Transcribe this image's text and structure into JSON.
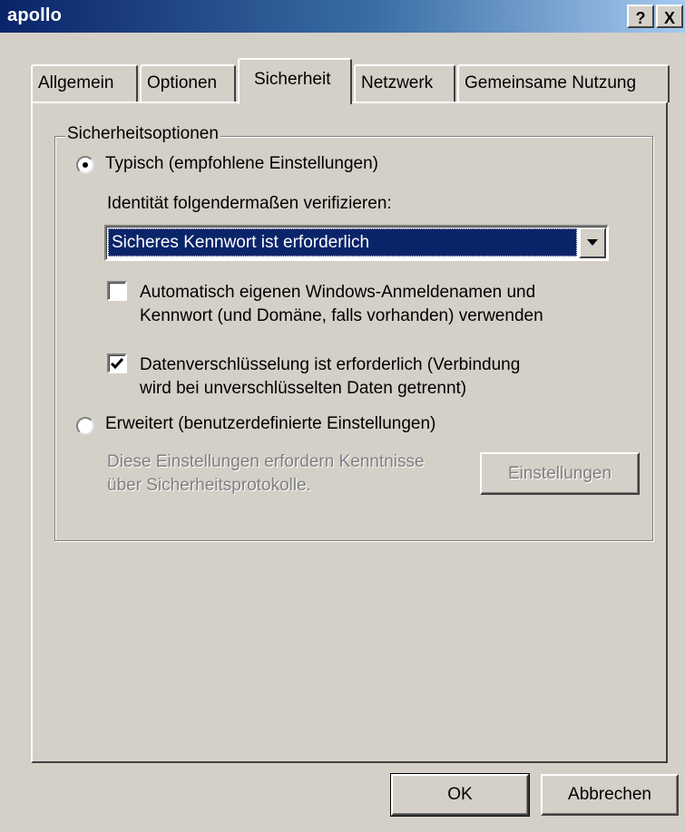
{
  "window": {
    "title": "apollo",
    "help_button": "?",
    "close_button": "X"
  },
  "tabs": [
    {
      "label": "Allgemein",
      "active": false
    },
    {
      "label": "Optionen",
      "active": false
    },
    {
      "label": "Sicherheit",
      "active": true
    },
    {
      "label": "Netzwerk",
      "active": false
    },
    {
      "label": "Gemeinsame Nutzung",
      "active": false
    }
  ],
  "security": {
    "group_title": "Sicherheitsoptionen",
    "typical": {
      "label": "Typisch (empfohlene Einstellungen)",
      "selected": true,
      "verify_label": "Identität folgendermaßen verifizieren:",
      "verify_value": "Sicheres Kennwort ist erforderlich",
      "auto_logon": {
        "line1": "Automatisch eigenen Windows-Anmeldenamen und",
        "line2": "Kennwort (und Domäne, falls vorhanden) verwenden",
        "checked": false
      },
      "encryption": {
        "line1": "Datenverschlüsselung ist erforderlich (Verbindung",
        "line2": "wird bei unverschlüsselten Daten getrennt)",
        "checked": true
      }
    },
    "advanced": {
      "label": "Erweitert (benutzerdefinierte Einstellungen)",
      "selected": false,
      "note_line1": "Diese Einstellungen erfordern Kenntnisse",
      "note_line2": "über Sicherheitsprotokolle.",
      "settings_button": "Einstellungen",
      "settings_enabled": false
    }
  },
  "footer": {
    "ok": "OK",
    "cancel": "Abbrechen"
  },
  "colors": {
    "titlebar_start": "#0a246a",
    "titlebar_end": "#a6caf0",
    "face": "#d4d0c8",
    "selection": "#0a246a",
    "disabled_text": "#808080"
  }
}
